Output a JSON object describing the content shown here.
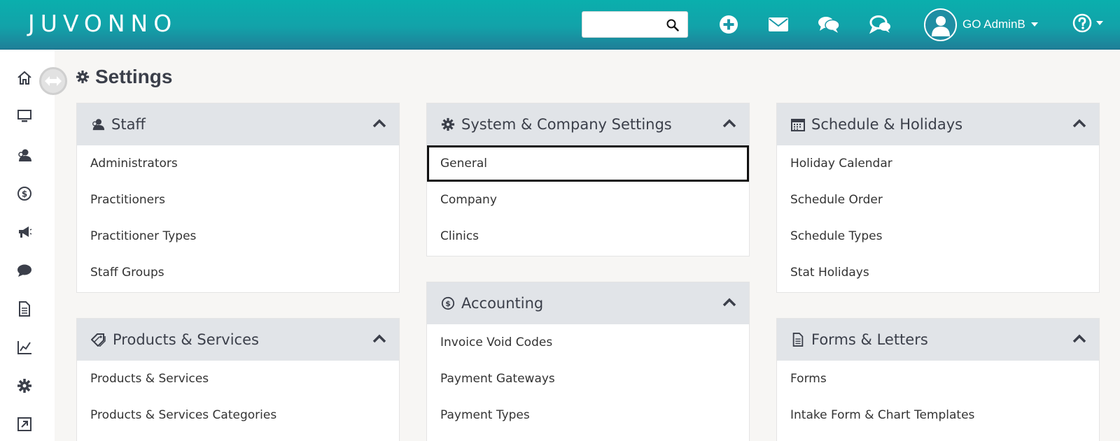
{
  "app": {
    "logo_text": "JUVONNO"
  },
  "header": {
    "search": {
      "placeholder": ""
    },
    "user_name": "GO AdminB",
    "icons": [
      "search-icon",
      "add-icon",
      "mail-icon",
      "chat-icon",
      "messages-icon",
      "user-icon",
      "help-icon"
    ]
  },
  "sidebar": {
    "items": [
      {
        "icon": "home-icon"
      },
      {
        "icon": "monitor-icon"
      },
      {
        "icon": "clients-icon"
      },
      {
        "icon": "billing-icon"
      },
      {
        "icon": "marketing-icon"
      },
      {
        "icon": "chat-icon"
      },
      {
        "icon": "document-icon"
      },
      {
        "icon": "reports-icon"
      },
      {
        "icon": "settings-icon"
      },
      {
        "icon": "external-link-icon"
      }
    ]
  },
  "page": {
    "title": "Settings"
  },
  "panels": {
    "staff": {
      "title": "Staff",
      "items": [
        "Administrators",
        "Practitioners",
        "Practitioner Types",
        "Staff Groups"
      ]
    },
    "products": {
      "title": "Products & Services",
      "items": [
        "Products & Services",
        "Products & Services Categories"
      ]
    },
    "system": {
      "title": "System & Company Settings",
      "items": [
        "General",
        "Company",
        "Clinics"
      ],
      "selected": "General"
    },
    "accounting": {
      "title": "Accounting",
      "items": [
        "Invoice Void Codes",
        "Payment Gateways",
        "Payment Types"
      ]
    },
    "schedule": {
      "title": "Schedule & Holidays",
      "items": [
        "Holiday Calendar",
        "Schedule Order",
        "Schedule Types",
        "Stat Holidays"
      ]
    },
    "forms": {
      "title": "Forms & Letters",
      "items": [
        "Forms",
        "Intake Form & Chart Templates"
      ]
    }
  },
  "colors": {
    "header_start": "#0aafad",
    "header_end": "#1f7f98",
    "panel_head": "#e1e4e8",
    "text_dark": "#3b3f4a"
  }
}
